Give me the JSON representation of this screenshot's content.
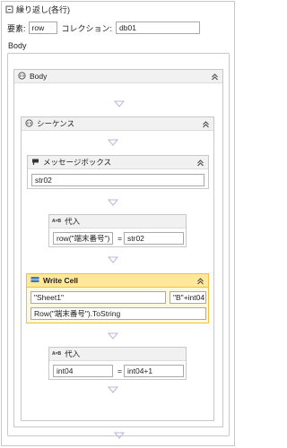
{
  "loop": {
    "title": "繰り返し(各行)",
    "element_label": "要素:",
    "element_value": "row",
    "collection_label": "コレクション:",
    "collection_value": "db01",
    "body_label": "Body"
  },
  "body_seq": {
    "title": "Body"
  },
  "sequence": {
    "title": "シーケンス"
  },
  "message_box": {
    "title": "メッセージボックス",
    "text": "str02"
  },
  "assign1": {
    "title": "代入",
    "icon_text": "A=B",
    "to": "row(\"端末番号\")",
    "eq": "=",
    "value": "str02"
  },
  "write_cell": {
    "title": "Write Cell",
    "sheet": "\"Sheet1\"",
    "cell": "\"B\"+int04",
    "value": "Row(\"端末番号\").ToString"
  },
  "assign2": {
    "title": "代入",
    "icon_text": "A=B",
    "to": "int04",
    "eq": "=",
    "value": "int04+1"
  },
  "colors": {
    "highlight_border": "#f0c23c",
    "highlight_header": "#ffe89c",
    "arrow": "#b8b8d8"
  },
  "icons": [
    "loop-icon",
    "sequence-icon",
    "collapse-icon",
    "message-box-icon",
    "assign-icon",
    "write-cell-icon",
    "arrow-down-icon"
  ]
}
